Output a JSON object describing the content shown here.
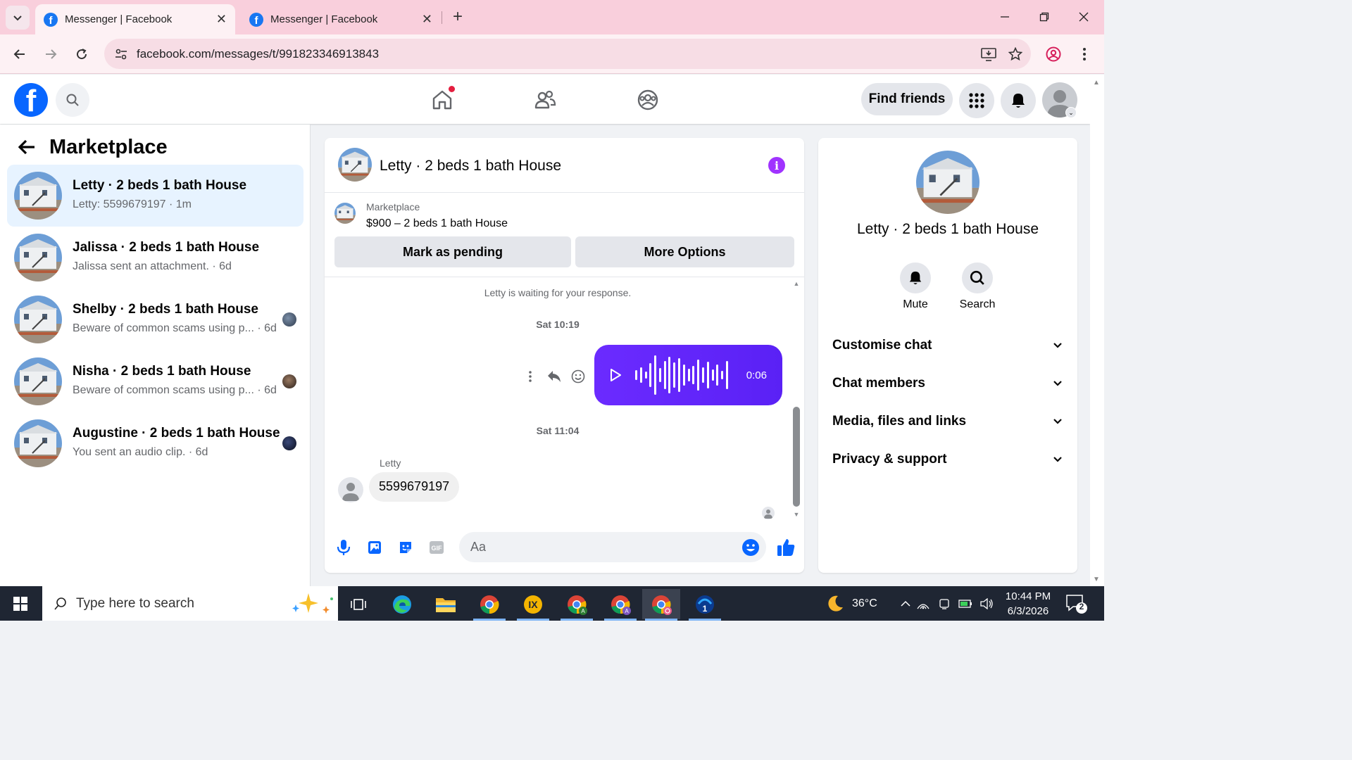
{
  "browser": {
    "tabs": [
      {
        "title": "Messenger | Facebook",
        "active": true
      },
      {
        "title": "Messenger | Facebook",
        "active": false
      }
    ],
    "url": "facebook.com/messages/t/991823346913843"
  },
  "header": {
    "find_friends_label": "Find friends"
  },
  "sidebar": {
    "title": "Marketplace",
    "conversations": [
      {
        "name": "Letty · 2 beds 1 bath House",
        "preview": "Letty: 5599679197 · 1m",
        "active": true
      },
      {
        "name": "Jalissa · 2 beds 1 bath House",
        "preview": "Jalissa sent an attachment. · 6d",
        "active": false
      },
      {
        "name": "Shelby · 2 beds 1 bath House",
        "preview": "Beware of common scams using p...  · 6d",
        "active": false
      },
      {
        "name": "Nisha · 2 beds 1 bath House",
        "preview": "Beware of common scams using p...  · 6d",
        "active": false
      },
      {
        "name": "Augustine · 2 beds 1 bath House",
        "preview": "You sent an audio clip. · 6d",
        "active": false
      }
    ]
  },
  "chat": {
    "title": "Letty · 2 beds 1 bath House",
    "listing": {
      "label": "Marketplace",
      "price_title": "$900 – 2 beds 1 bath House",
      "mark_pending_label": "Mark as pending",
      "more_options_label": "More Options"
    },
    "waiting_text": "Letty is waiting for your response.",
    "timestamp_1": "Sat 10:19",
    "audio_duration": "0:06",
    "timestamp_2": "Sat 11:04",
    "sender_name": "Letty",
    "incoming_message": "5599679197",
    "composer_placeholder": "Aa"
  },
  "info_panel": {
    "name": "Letty · 2 beds 1 bath House",
    "mute_label": "Mute",
    "search_label": "Search",
    "sections": [
      "Customise chat",
      "Chat members",
      "Media, files and links",
      "Privacy & support"
    ]
  },
  "taskbar": {
    "search_placeholder": "Type here to search",
    "temperature": "36°C",
    "time": "10:44 PM",
    "date": "6/3/2026",
    "notification_count": "2"
  },
  "colors": {
    "facebook_blue": "#0866ff",
    "messenger_purple": "#5a21f5",
    "active_conversation": "#e7f3ff",
    "tab_bar_pink": "#f9cfdc"
  }
}
